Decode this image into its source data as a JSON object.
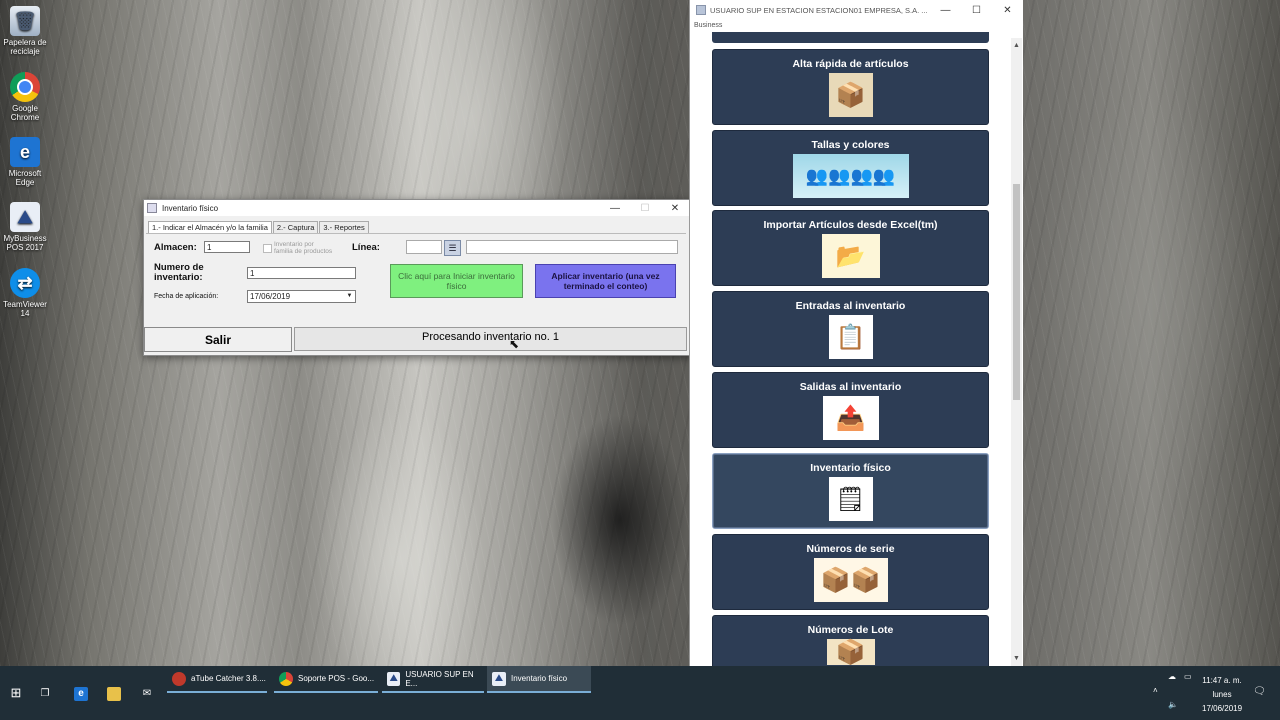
{
  "desktop": {
    "icons": [
      {
        "label": "Papelera de reciclaje",
        "icon": "recycle-bin-icon"
      },
      {
        "label": "Google Chrome",
        "icon": "chrome-icon"
      },
      {
        "label": "Microsoft Edge",
        "icon": "edge-icon"
      },
      {
        "label": "MyBusiness POS 2017",
        "icon": "mybusiness-icon"
      },
      {
        "label": "TeamViewer 14",
        "icon": "teamviewer-icon"
      }
    ]
  },
  "inventory_window": {
    "title": "Inventario físico",
    "tabs": [
      "1.- Indicar el Almacén y/o la familia",
      "2.- Captura",
      "3.- Reportes"
    ],
    "almacen_label": "Almacen:",
    "almacen_value": "1",
    "checkbox_label": "Inventario por familia de productos",
    "linea_label": "Línea:",
    "linea_code": "",
    "linea_desc": "",
    "numero_label": "Numero de inventario:",
    "numero_value": "1",
    "fecha_label": "Fecha de aplicación:",
    "fecha_value": "17/06/2019",
    "iniciar_button": "Clic aquí para Iniciar inventario físico",
    "aplicar_button": "Aplicar inventario  (una vez terminado el conteo)",
    "salir_button": "Salir",
    "status_text": "Procesando inventario no. 1"
  },
  "app_window": {
    "title": "USUARIO SUP EN ESTACION ESTACION01    EMPRESA, S.A. ...",
    "subtitle": "Business",
    "tiles": [
      {
        "label": "Alta rápida de artículos",
        "icon": "box-icon"
      },
      {
        "label": "Tallas y colores",
        "icon": "people-icon"
      },
      {
        "label": "Importar Artículos desde Excel(tm)",
        "icon": "folder-import-icon"
      },
      {
        "label": "Entradas al inventario",
        "icon": "document-box-icon"
      },
      {
        "label": "Salidas al inventario",
        "icon": "box-arrow-icon"
      },
      {
        "label": "Inventario físico",
        "icon": "clipboard-box-icon"
      },
      {
        "label": "Números de serie",
        "icon": "stacked-boxes-icon"
      },
      {
        "label": "Números de Lote",
        "icon": "boxes-icon"
      }
    ]
  },
  "taskbar": {
    "items": [
      {
        "label": "aTube Catcher 3.8....",
        "icon": "atube-icon"
      },
      {
        "label": "Soporte POS - Goo...",
        "icon": "chrome-icon"
      },
      {
        "label": "USUARIO SUP EN E...",
        "icon": "mybusiness-icon"
      },
      {
        "label": "Inventario físico",
        "icon": "mybusiness-icon"
      }
    ],
    "time": "11:47 a. m.",
    "day": "lunes",
    "date": "17/06/2019"
  }
}
